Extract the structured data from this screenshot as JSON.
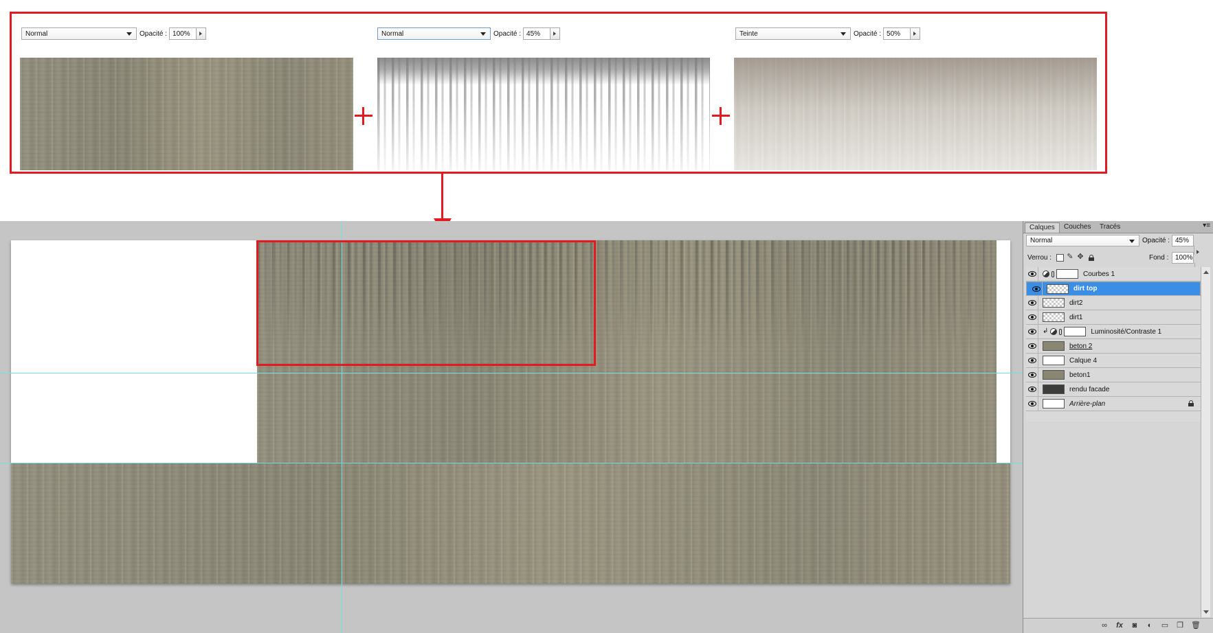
{
  "combo": {
    "panels": [
      {
        "blend_mode": "Normal",
        "opacity_label": "Opacité :",
        "opacity": "100%"
      },
      {
        "blend_mode": "Normal",
        "opacity_label": "Opacité :",
        "opacity": "45%"
      },
      {
        "blend_mode": "Teinte",
        "opacity_label": "Opacité :",
        "opacity": "50%"
      }
    ]
  },
  "colors": {
    "highlight": "#e21a22",
    "selection": "#3b8ee6",
    "guide": "#6fe3e3"
  },
  "layers_panel": {
    "tabs": [
      "Calques",
      "Couches",
      "Tracés"
    ],
    "active_tab": "Calques",
    "blend_mode": "Normal",
    "opacity_label": "Opacité :",
    "opacity": "45%",
    "lock_label": "Verrou :",
    "fill_label": "Fond :",
    "fill": "100%",
    "layers": [
      {
        "name": "Courbes 1",
        "type": "adjustment",
        "selected": false
      },
      {
        "name": "dirt top",
        "type": "pixel",
        "selected": true
      },
      {
        "name": "dirt2",
        "type": "pixel",
        "selected": false
      },
      {
        "name": "dirt1",
        "type": "pixel",
        "selected": false
      },
      {
        "name": "Luminosité/Contraste 1",
        "type": "adjustment-clipped",
        "selected": false
      },
      {
        "name": "beton 2",
        "type": "pixel",
        "selected": false
      },
      {
        "name": "Calque 4",
        "type": "pixel",
        "selected": false
      },
      {
        "name": "beton1",
        "type": "pixel",
        "selected": false
      },
      {
        "name": "rendu facade",
        "type": "pixel",
        "selected": false
      },
      {
        "name": "Arrière-plan",
        "type": "background",
        "selected": false
      }
    ],
    "bottom_icons": [
      "link-icon",
      "fx-icon",
      "mask-icon",
      "adjustment-icon",
      "group-icon",
      "new-layer-icon",
      "trash-icon"
    ]
  }
}
